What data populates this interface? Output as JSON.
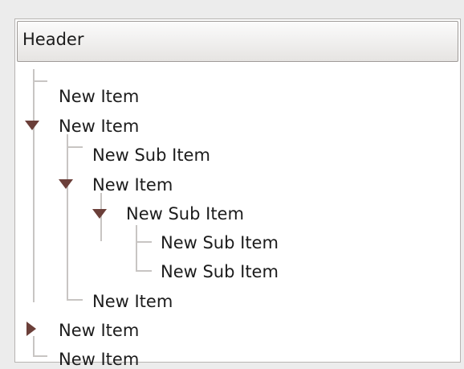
{
  "tree": {
    "header": "Header",
    "rows": [
      {
        "label": "New Item",
        "level": 0,
        "state": "leaf"
      },
      {
        "label": "New Item",
        "level": 0,
        "state": "expanded"
      },
      {
        "label": "New Sub Item",
        "level": 1,
        "state": "leaf"
      },
      {
        "label": "New Item",
        "level": 1,
        "state": "expanded"
      },
      {
        "label": "New Sub Item",
        "level": 2,
        "state": "expanded"
      },
      {
        "label": "New Sub Item",
        "level": 3,
        "state": "leaf"
      },
      {
        "label": "New Sub Item",
        "level": 3,
        "state": "leaf"
      },
      {
        "label": "New Item",
        "level": 1,
        "state": "leaf"
      },
      {
        "label": "New Item",
        "level": 0,
        "state": "collapsed"
      },
      {
        "label": "New Item",
        "level": 0,
        "state": "leaf"
      }
    ]
  },
  "colors": {
    "expander": "#6b3f39",
    "tree_lines": "#c8c5c3",
    "border": "#b7b4b2"
  }
}
